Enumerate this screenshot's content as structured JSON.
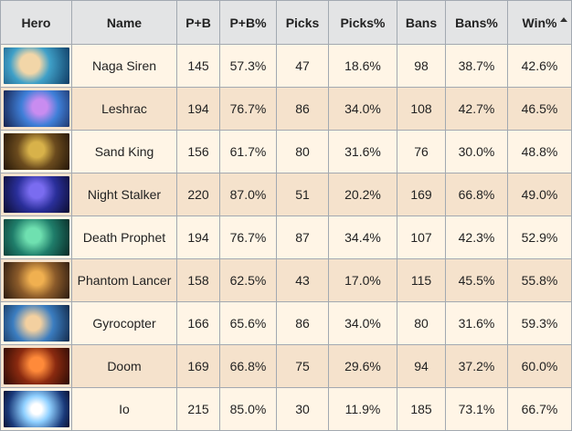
{
  "headers": [
    "Hero",
    "Name",
    "P+B",
    "P+B%",
    "Picks",
    "Picks%",
    "Bans",
    "Bans%",
    "Win%"
  ],
  "sorted_column": "Win%",
  "rows": [
    {
      "icon": "naga-siren-portrait",
      "name": "Naga Siren",
      "pb": "145",
      "pb_pct": "57.3%",
      "picks": "47",
      "picks_pct": "18.6%",
      "bans": "98",
      "bans_pct": "38.7%",
      "win_pct": "42.6%"
    },
    {
      "icon": "leshrac-portrait",
      "name": "Leshrac",
      "pb": "194",
      "pb_pct": "76.7%",
      "picks": "86",
      "picks_pct": "34.0%",
      "bans": "108",
      "bans_pct": "42.7%",
      "win_pct": "46.5%"
    },
    {
      "icon": "sand-king-portrait",
      "name": "Sand King",
      "pb": "156",
      "pb_pct": "61.7%",
      "picks": "80",
      "picks_pct": "31.6%",
      "bans": "76",
      "bans_pct": "30.0%",
      "win_pct": "48.8%"
    },
    {
      "icon": "night-stalker-portrait",
      "name": "Night Stalker",
      "pb": "220",
      "pb_pct": "87.0%",
      "picks": "51",
      "picks_pct": "20.2%",
      "bans": "169",
      "bans_pct": "66.8%",
      "win_pct": "49.0%"
    },
    {
      "icon": "death-prophet-portrait",
      "name": "Death Prophet",
      "pb": "194",
      "pb_pct": "76.7%",
      "picks": "87",
      "picks_pct": "34.4%",
      "bans": "107",
      "bans_pct": "42.3%",
      "win_pct": "52.9%"
    },
    {
      "icon": "phantom-lancer-portrait",
      "name": "Phantom Lancer",
      "pb": "158",
      "pb_pct": "62.5%",
      "picks": "43",
      "picks_pct": "17.0%",
      "bans": "115",
      "bans_pct": "45.5%",
      "win_pct": "55.8%"
    },
    {
      "icon": "gyrocopter-portrait",
      "name": "Gyrocopter",
      "pb": "166",
      "pb_pct": "65.6%",
      "picks": "86",
      "picks_pct": "34.0%",
      "bans": "80",
      "bans_pct": "31.6%",
      "win_pct": "59.3%"
    },
    {
      "icon": "doom-portrait",
      "name": "Doom",
      "pb": "169",
      "pb_pct": "66.8%",
      "picks": "75",
      "picks_pct": "29.6%",
      "bans": "94",
      "bans_pct": "37.2%",
      "win_pct": "60.0%"
    },
    {
      "icon": "io-portrait",
      "name": "Io",
      "pb": "215",
      "pb_pct": "85.0%",
      "picks": "30",
      "picks_pct": "11.9%",
      "bans": "185",
      "bans_pct": "73.1%",
      "win_pct": "66.7%"
    }
  ]
}
